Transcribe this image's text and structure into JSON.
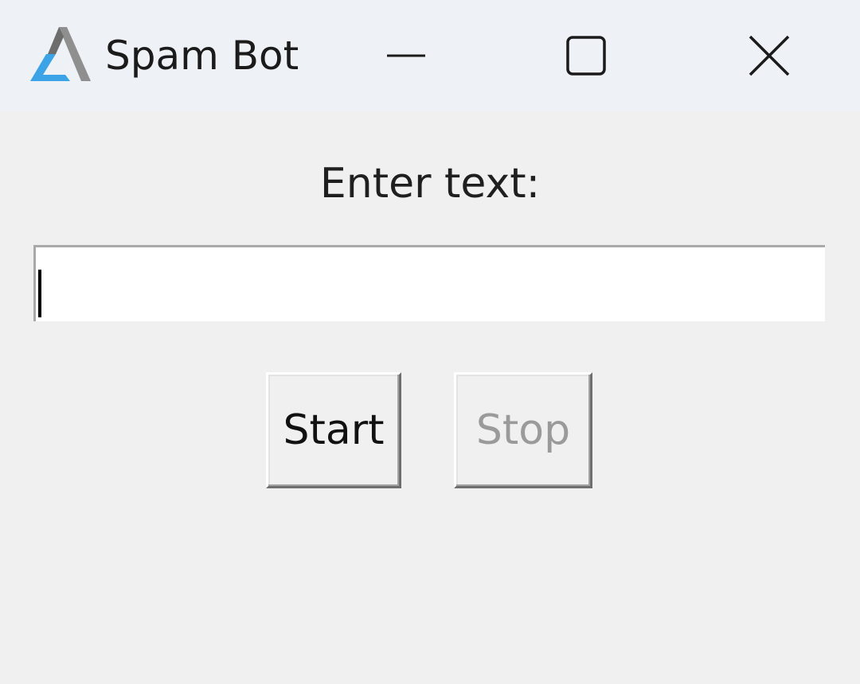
{
  "window": {
    "title": "Spam Bot",
    "icon": "app-logo-icon",
    "controls": {
      "minimize": "minimize-icon",
      "maximize": "maximize-icon",
      "close": "close-icon"
    }
  },
  "form": {
    "prompt_label": "Enter text:",
    "text_value": "",
    "start_label": "Start",
    "stop_label": "Stop",
    "stop_enabled": false
  },
  "colors": {
    "titlebar_bg": "#eef1f6",
    "window_bg": "#f0f0f0",
    "icon_blue": "#3ba3e6",
    "icon_gray": "#8a8a8a",
    "disabled_text": "#9a9a9a"
  }
}
